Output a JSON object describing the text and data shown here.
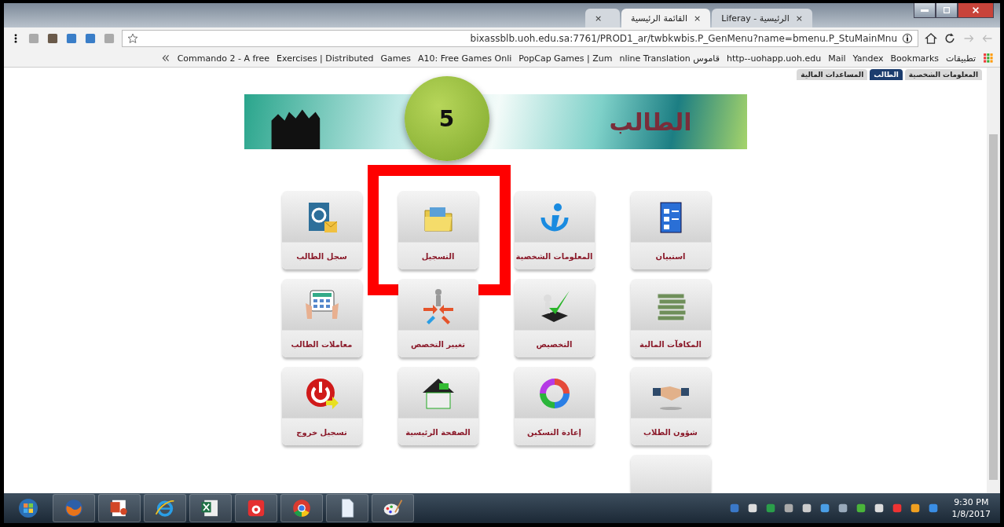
{
  "browser_tabs": [
    {
      "label": "Liferay - الرئيسية",
      "close": "×",
      "selected": false
    },
    {
      "label": "القائمة الرئيسية",
      "close": "×",
      "selected": true
    },
    {
      "close": "×",
      "selected": false
    }
  ],
  "address": {
    "url": "bixassblb.uoh.edu.sa:7761/PROD1_ar/twbkwbis.P_GenMenu?name=bmenu.P_StuMainMnu"
  },
  "bookmarks": [
    {
      "label": "تطبيقات"
    },
    {
      "label": "Bookmarks"
    },
    {
      "label": "Yandex"
    },
    {
      "label": "Mail"
    },
    {
      "label": "http--uohapp.uoh.edu"
    },
    {
      "label": "nline Translation قاموس"
    },
    {
      "label": "PopCap Games | Zum"
    },
    {
      "label": "A10: Free Games Onli"
    },
    {
      "label": "Games"
    },
    {
      "label": "Exercises | Distributed"
    },
    {
      "label": "Commando 2 - A free"
    }
  ],
  "page_tabs": [
    {
      "label": "المعلومات الشخصية",
      "selected": false
    },
    {
      "label": "الطالب",
      "selected": true
    },
    {
      "label": "المساعدات المالية",
      "selected": false
    }
  ],
  "banner": {
    "title": "الطالب",
    "step": "5"
  },
  "tiles": [
    {
      "label": "استبيان",
      "kind": "survey",
      "highlighted": false
    },
    {
      "label": "المعلومات الشخصية",
      "kind": "info",
      "highlighted": false
    },
    {
      "label": "التسجيل",
      "kind": "folder",
      "highlighted": true
    },
    {
      "label": "سجل الطالب",
      "kind": "mail",
      "highlighted": false
    },
    {
      "label": "المكافآت المالية",
      "kind": "money",
      "highlighted": false
    },
    {
      "label": "التخصيص",
      "kind": "check",
      "highlighted": false
    },
    {
      "label": "تغيير التخصص",
      "kind": "arrows",
      "highlighted": false
    },
    {
      "label": "معاملات الطالب",
      "kind": "tablet",
      "highlighted": false
    },
    {
      "label": "شؤون الطلاب",
      "kind": "handshake",
      "highlighted": false
    },
    {
      "label": "إعادة التسكين",
      "kind": "cycle",
      "highlighted": false
    },
    {
      "label": "الصفحة الرئيسية",
      "kind": "house",
      "highlighted": false
    },
    {
      "label": "تسجيل خروج",
      "kind": "power",
      "highlighted": false
    },
    {
      "kind": "partial",
      "highlighted": false
    }
  ],
  "taskbar": [
    {
      "kind": "start"
    },
    {
      "kind": "firefox"
    },
    {
      "kind": "powerpoint"
    },
    {
      "kind": "ie"
    },
    {
      "kind": "excel"
    },
    {
      "kind": "recorder"
    },
    {
      "kind": "chrome"
    },
    {
      "kind": "document"
    },
    {
      "kind": "paint"
    }
  ],
  "clock": {
    "time": "9:30 PM",
    "date": "1/8/2017"
  }
}
